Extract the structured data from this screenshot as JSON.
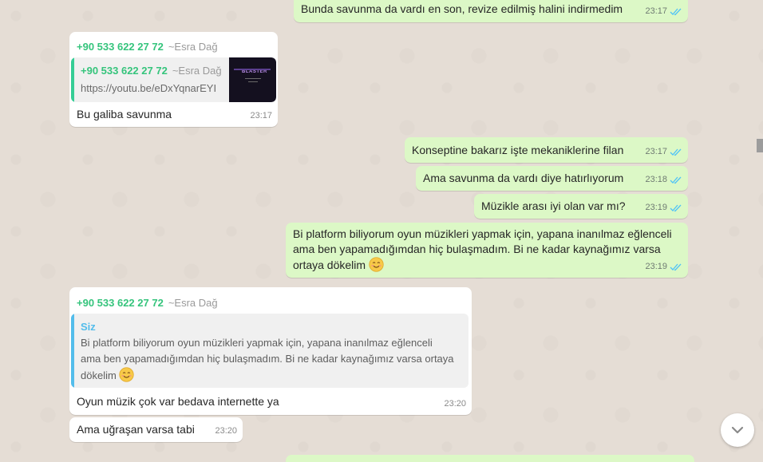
{
  "messages": {
    "m1": {
      "text": "Bunda savunma da vardı en son, revize edilmiş halini indirmedim",
      "time": "23:17"
    },
    "m2": {
      "sender": "+90 533 622 27 72",
      "pushname": "~Esra Dağ",
      "quote_sender": "+90 533 622 27 72",
      "quote_pushname": "~Esra Dağ",
      "quote_text": "https://youtu.be/eDxYqnarEYI",
      "thumb_label": "BLASTER",
      "text": "Bu galiba savunma",
      "time": "23:17"
    },
    "m3": {
      "text": "Konseptine bakarız işte mekaniklerine filan",
      "time": "23:17"
    },
    "m4": {
      "text": "Ama savunma da vardı diye hatırlıyorum",
      "time": "23:18"
    },
    "m5": {
      "text": "Müzikle arası iyi olan var mı?",
      "time": "23:19"
    },
    "m6": {
      "line1": "Bi platform biliyorum oyun müzikleri yapmak için, yapana inanılmaz eğlenceli",
      "line2": "ama ben yapamadığımdan hiç bulaşmadım. Bi ne kadar kaynağımız varsa",
      "line3": "ortaya dökelim",
      "time": "23:19"
    },
    "m7": {
      "sender": "+90 533 622 27 72",
      "pushname": "~Esra Dağ",
      "quote_sender": "Siz",
      "quote_line1": "Bi platform biliyorum oyun müzikleri yapmak için, yapana inanılmaz eğlenceli",
      "quote_line2": "ama ben yapamadığımdan hiç bulaşmadım. Bi ne kadar kaynağımız varsa ortaya",
      "quote_line3": "dökelim",
      "text": "Oyun müzik çok var bedava internette ya",
      "time": "23:20"
    },
    "m8": {
      "text": "Ama uğraşan varsa tabi",
      "time": "23:20"
    }
  },
  "colors": {
    "outgoing_bubble": "#dcf8c6",
    "incoming_bubble": "#ffffff",
    "sender_name": "#35c47c",
    "read_ticks": "#4fc3f7",
    "quote_self_bar": "#53bdeb"
  },
  "icons": {
    "read_receipt": "double-check-icon",
    "emoji": "smiling-face-icon",
    "scroll_down": "chevron-down-icon"
  }
}
